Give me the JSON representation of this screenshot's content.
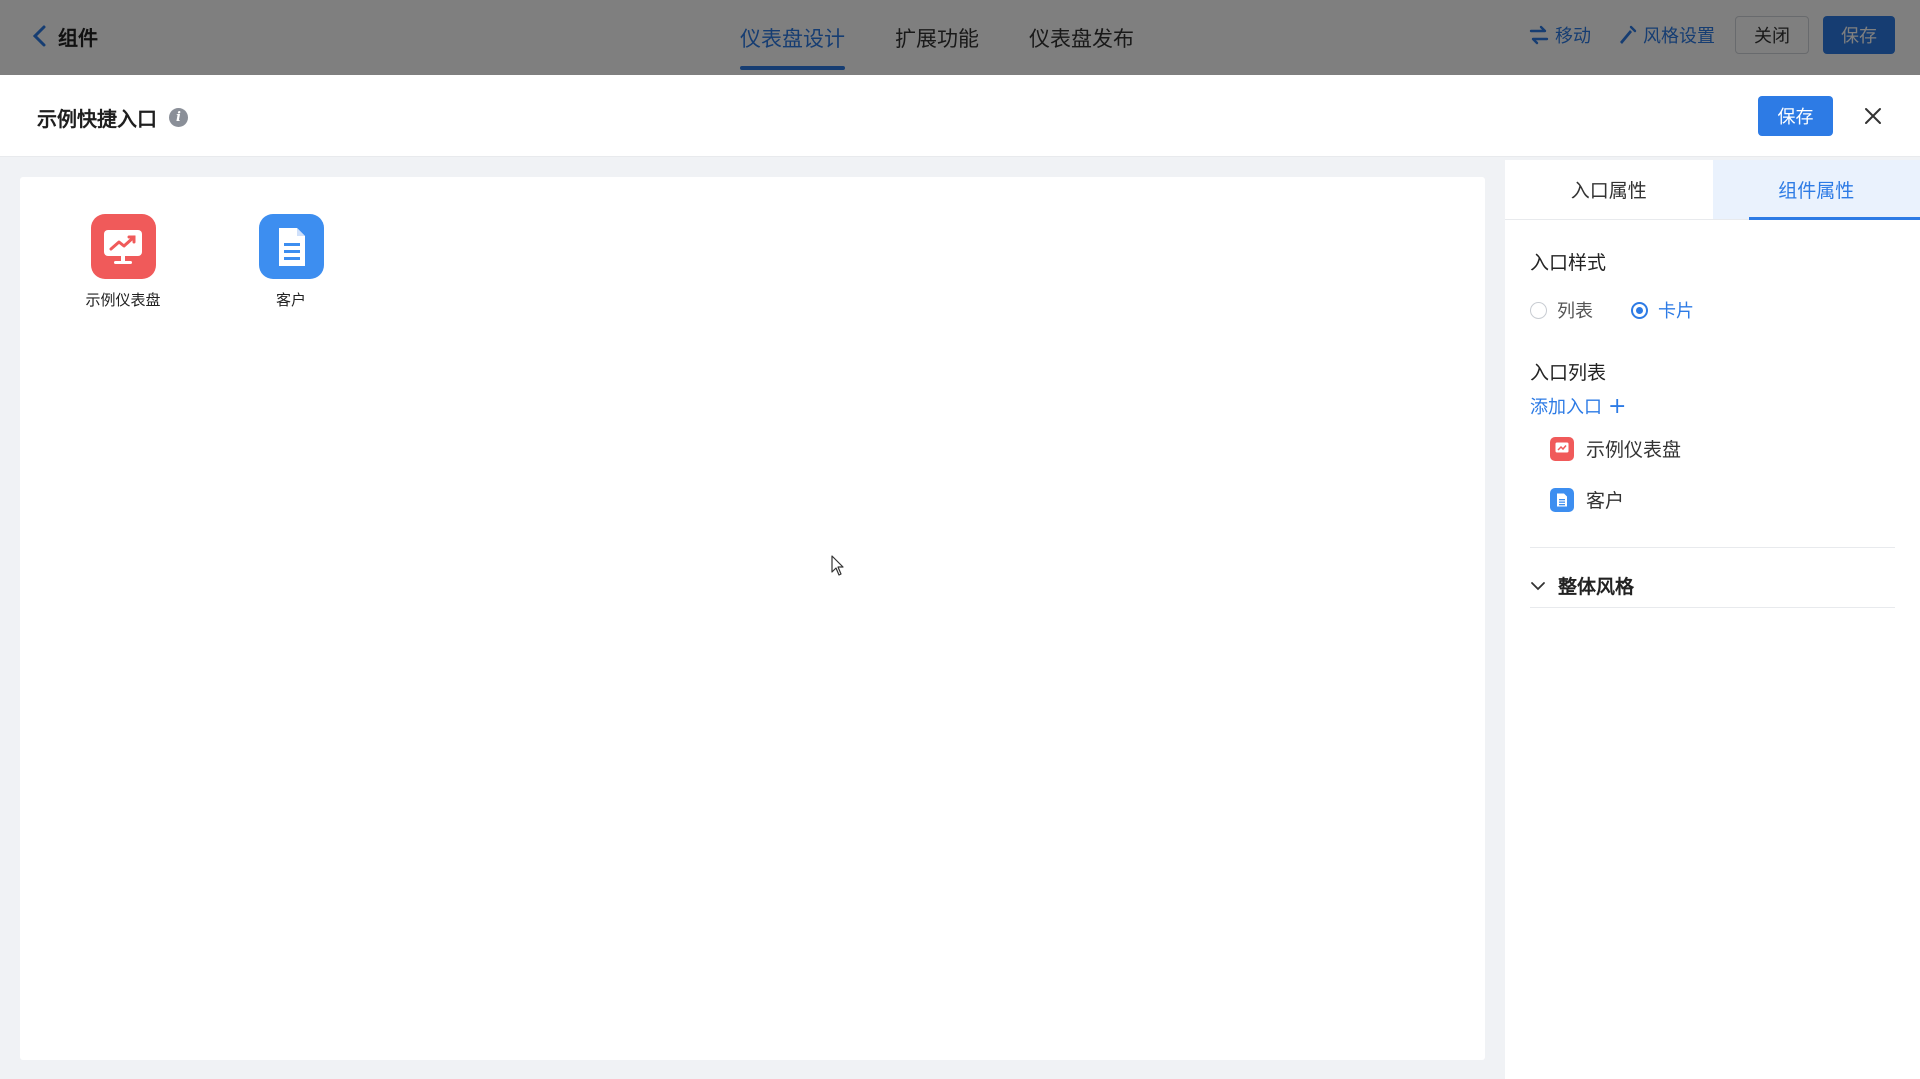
{
  "topbar": {
    "back_label": "组件",
    "tabs": [
      {
        "label": "仪表盘设计",
        "active": true
      },
      {
        "label": "扩展功能",
        "active": false
      },
      {
        "label": "仪表盘发布",
        "active": false
      }
    ],
    "move_label": "移动",
    "style_label": "风格设置",
    "close_label": "关闭",
    "save_label": "保存"
  },
  "modal": {
    "title": "示例快捷入口",
    "info_icon": "i",
    "save_label": "保存"
  },
  "canvas": {
    "entries": [
      {
        "label": "示例仪表盘",
        "icon": "dashboard-chart-icon",
        "color": "#f05a5a"
      },
      {
        "label": "客户",
        "icon": "document-icon",
        "color": "#3d8ef0"
      }
    ]
  },
  "panel": {
    "tabs": [
      {
        "label": "入口属性",
        "active": false
      },
      {
        "label": "组件属性",
        "active": true
      }
    ],
    "entry_style_label": "入口样式",
    "style_options": [
      {
        "label": "列表",
        "checked": false
      },
      {
        "label": "卡片",
        "checked": true
      }
    ],
    "entry_list_label": "入口列表",
    "add_entry_label": "添加入口",
    "add_plus": "+",
    "entries": [
      {
        "label": "示例仪表盘",
        "icon": "dashboard-chart-icon"
      },
      {
        "label": "客户",
        "icon": "document-icon"
      }
    ],
    "overall_style_label": "整体风格"
  },
  "colors": {
    "primary": "#2d7be5",
    "red_icon": "#f05a5a",
    "blue_icon": "#3d8ef0"
  }
}
